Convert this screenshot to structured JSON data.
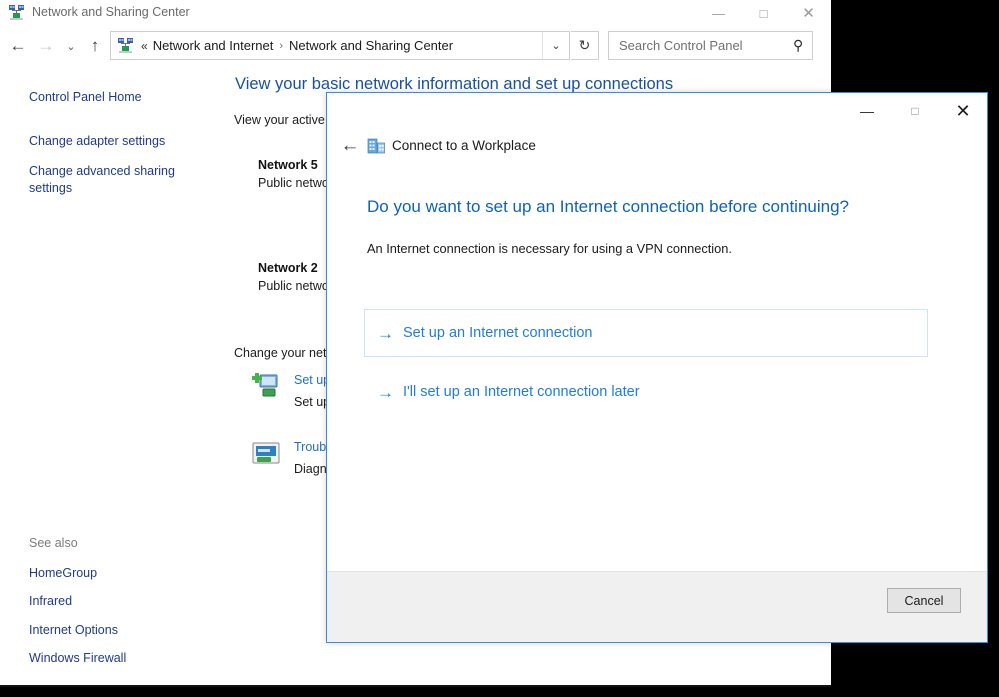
{
  "main_window": {
    "title": "Network and Sharing Center",
    "title_icon": "network-icon",
    "controls": {
      "minimize": "—",
      "maximize": "□",
      "close": "✕"
    },
    "nav": {
      "back": "←",
      "forward": "→",
      "recent": "⌄",
      "up": "↑"
    },
    "address": {
      "icon": "network-icon",
      "overflow_chevron": "«",
      "segments": [
        "Network and Internet",
        "Network and Sharing Center"
      ],
      "separator": "›",
      "dropdown": "⌄"
    },
    "refresh": "↻",
    "search": {
      "placeholder": "Search Control Panel",
      "value": "",
      "icon": "search-icon"
    },
    "left_pane": {
      "home": "Control Panel Home",
      "links": [
        "Change adapter settings",
        "Change advanced sharing settings"
      ],
      "see_also_header": "See also",
      "see_also": [
        "HomeGroup",
        "Infrared",
        "Internet Options",
        "Windows Firewall"
      ]
    },
    "content": {
      "heading": "View your basic network information and set up connections",
      "subheading": "View your active networks",
      "networks": [
        {
          "name": "Network 5",
          "type": "Public network"
        },
        {
          "name": "Network 2",
          "type": "Public network"
        }
      ],
      "change_settings_header": "Change your networking settings",
      "tasks": [
        {
          "icon": "new-connection-icon",
          "link": "Set up a new connection or network",
          "desc": "Set up a broadband, dial-up, or VPN connection; or set up a router or access point."
        },
        {
          "icon": "troubleshoot-icon",
          "link": "Troubleshoot problems",
          "desc": "Diagnose and repair network problems, or get troubleshooting information."
        }
      ]
    }
  },
  "dialog": {
    "title": "Connect to a Workplace",
    "title_icon": "workplace-building-icon",
    "back_arrow": "←",
    "controls": {
      "minimize": "—",
      "maximize": "□",
      "close": "✕"
    },
    "question": "Do you want to set up an Internet connection before continuing?",
    "description": "An Internet connection is necessary for using a VPN connection.",
    "choices": [
      {
        "arrow": "→",
        "label": "Set up an Internet connection"
      },
      {
        "arrow": "→",
        "label": "I'll set up an Internet connection later"
      }
    ],
    "cancel_label": "Cancel"
  },
  "colors": {
    "accent_blue": "#1f7ddb",
    "heading_blue": "#17519e",
    "link_blue": "#1f3b8c",
    "dialog_border": "#3a8dde",
    "footer_bg": "#f0f0f0"
  }
}
